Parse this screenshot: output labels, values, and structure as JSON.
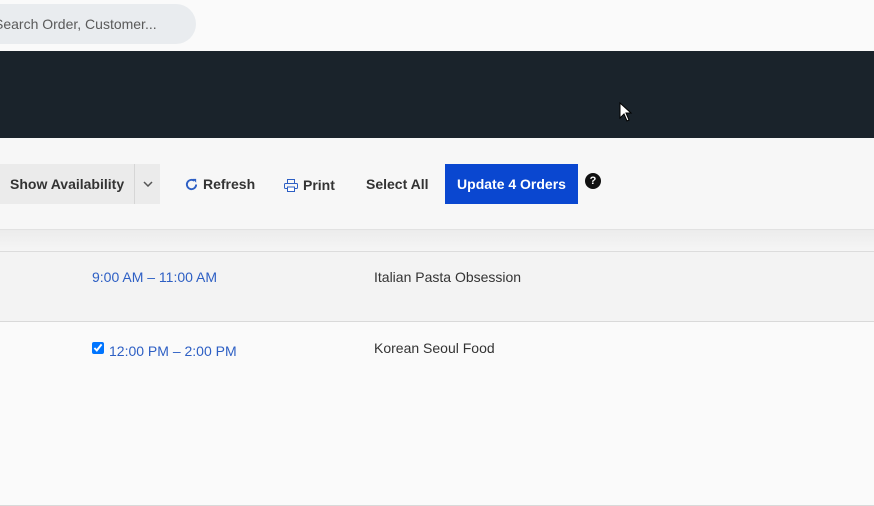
{
  "search": {
    "placeholder": "Search Order, Customer..."
  },
  "toolbar": {
    "availability_label": "Show Availability",
    "refresh_label": "Refresh",
    "print_label": "Print",
    "select_all_label": "Select All",
    "update_label": "Update 4 Orders",
    "help_glyph": "?"
  },
  "orders": [
    {
      "time": "9:00 AM – 11:00 AM",
      "name": "Italian Pasta Obsession",
      "checked": false
    },
    {
      "time": "12:00 PM – 2:00 PM",
      "name": "Korean Seoul Food",
      "checked": true
    }
  ],
  "colors": {
    "accent": "#0a47d0",
    "link": "#2d5fc4",
    "header": "#1a232b"
  },
  "icons": [
    "chevron-down-icon",
    "refresh-icon",
    "print-icon",
    "help-icon",
    "cursor-icon"
  ]
}
